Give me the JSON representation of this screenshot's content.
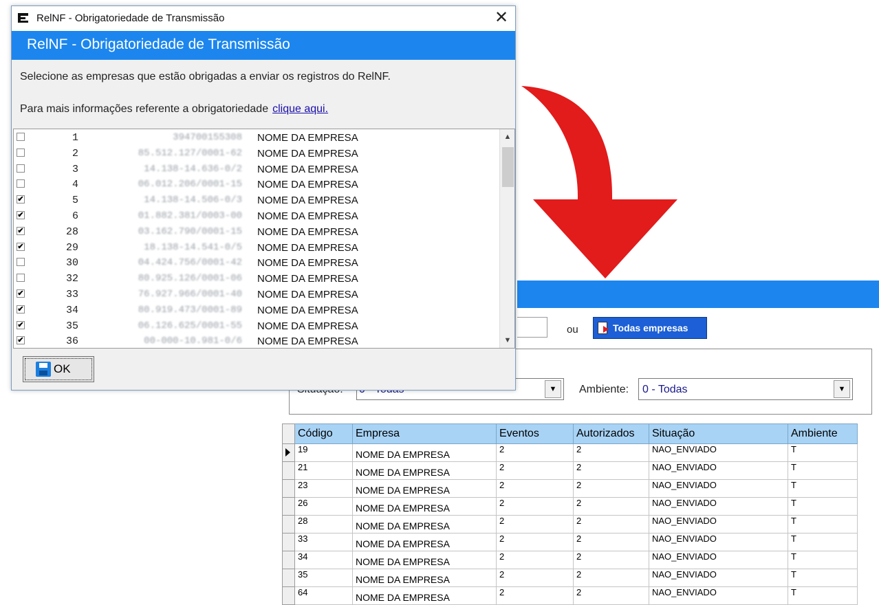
{
  "dialog": {
    "window_title": "RelNF - Obrigatoriedade de Transmissão",
    "banner_title": "RelNF - Obrigatoriedade de Transmissão",
    "close_glyph": "✕",
    "instruction": "Selecione as empresas que estão obrigadas a enviar os registros do RelNF.",
    "more_info_text": "Para mais informações referente a obrigatoriedade",
    "more_info_link": "clique aqui.",
    "ok_label": "OK",
    "items": [
      {
        "checked": false,
        "code": "1",
        "cnpj": "394700155308",
        "name": "NOME DA EMPRESA"
      },
      {
        "checked": false,
        "code": "2",
        "cnpj": "85.512.127/0001-62",
        "name": "NOME DA EMPRESA"
      },
      {
        "checked": false,
        "code": "3",
        "cnpj": "14.138-14.636-0/2",
        "name": "NOME DA EMPRESA"
      },
      {
        "checked": false,
        "code": "4",
        "cnpj": "06.012.206/0001-15",
        "name": "NOME DA EMPRESA"
      },
      {
        "checked": true,
        "code": "5",
        "cnpj": "14.138-14.506-0/3",
        "name": "NOME DA EMPRESA"
      },
      {
        "checked": true,
        "code": "6",
        "cnpj": "01.882.381/0003-00",
        "name": "NOME DA EMPRESA"
      },
      {
        "checked": true,
        "code": "28",
        "cnpj": "03.162.790/0001-15",
        "name": "NOME DA EMPRESA"
      },
      {
        "checked": true,
        "code": "29",
        "cnpj": "18.138-14.541-0/5",
        "name": "NOME DA EMPRESA"
      },
      {
        "checked": false,
        "code": "30",
        "cnpj": "04.424.756/0001-42",
        "name": "NOME DA EMPRESA"
      },
      {
        "checked": false,
        "code": "32",
        "cnpj": "80.925.126/0001-06",
        "name": "NOME DA EMPRESA"
      },
      {
        "checked": true,
        "code": "33",
        "cnpj": "76.927.966/0001-40",
        "name": "NOME DA EMPRESA"
      },
      {
        "checked": true,
        "code": "34",
        "cnpj": "80.919.473/0001-89",
        "name": "NOME DA EMPRESA"
      },
      {
        "checked": true,
        "code": "35",
        "cnpj": "06.126.625/0001-55",
        "name": "NOME DA EMPRESA"
      },
      {
        "checked": true,
        "code": "36",
        "cnpj": "00-000-10.981-0/6",
        "name": "NOME DA EMPRESA"
      }
    ]
  },
  "background": {
    "or_label": "ou",
    "all_companies_button": "Todas empresas",
    "situacao_label": "Situação:",
    "situacao_value": "0 - Todas",
    "ambiente_label": "Ambiente:",
    "ambiente_value": "0 - Todas",
    "grid": {
      "columns": [
        "Código",
        "Empresa",
        "Eventos",
        "Autorizados",
        "Situação",
        "Ambiente"
      ],
      "rows": [
        [
          "19",
          "NOME DA EMPRESA",
          "2",
          "2",
          "NAO_ENVIADO",
          "T"
        ],
        [
          "21",
          "NOME DA EMPRESA",
          "2",
          "2",
          "NAO_ENVIADO",
          "T"
        ],
        [
          "23",
          "NOME DA EMPRESA",
          "2",
          "2",
          "NAO_ENVIADO",
          "T"
        ],
        [
          "26",
          "NOME DA EMPRESA",
          "2",
          "2",
          "NAO_ENVIADO",
          "T"
        ],
        [
          "28",
          "NOME DA EMPRESA",
          "2",
          "2",
          "NAO_ENVIADO",
          "T"
        ],
        [
          "33",
          "NOME DA EMPRESA",
          "2",
          "2",
          "NAO_ENVIADO",
          "T"
        ],
        [
          "34",
          "NOME DA EMPRESA",
          "2",
          "2",
          "NAO_ENVIADO",
          "T"
        ],
        [
          "35",
          "NOME DA EMPRESA",
          "2",
          "2",
          "NAO_ENVIADO",
          "T"
        ],
        [
          "64",
          "NOME DA EMPRESA",
          "2",
          "2",
          "NAO_ENVIADO",
          "T"
        ]
      ]
    }
  },
  "colors": {
    "banner_blue": "#1c86ee",
    "grid_header": "#a8d3f5",
    "arrow_red": "#e21b1b"
  }
}
